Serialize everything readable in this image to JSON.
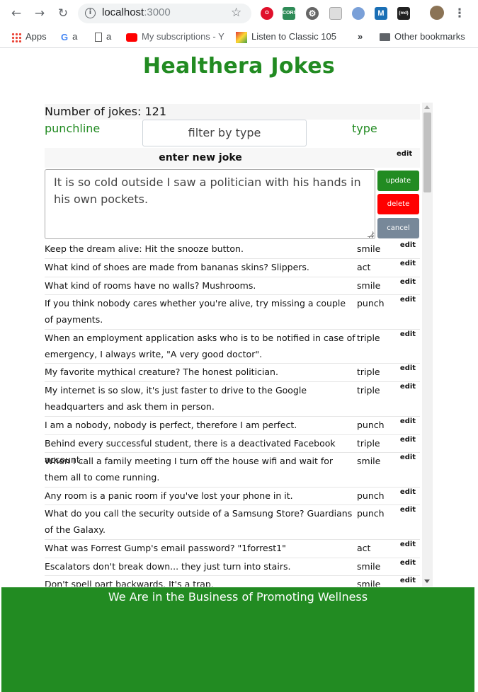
{
  "browser": {
    "url_host": "localhost",
    "url_port": ":3000",
    "bookmarks": {
      "apps": "Apps",
      "g_a": "a",
      "doc_a": "a",
      "youtube": "My subscriptions - Y",
      "classic": "Listen to Classic 105",
      "more": "»",
      "other": "Other bookmarks"
    },
    "extensions": [
      "opera-icon",
      "cors-icon",
      "gear-ext-icon",
      "calendar-ext-icon",
      "circle-ext-icon",
      "m-ext-icon",
      "terminal-ext-icon"
    ],
    "ext_labels": {
      "cors": "CORS",
      "m": "M",
      "terminal": "{md}"
    }
  },
  "page": {
    "title": "Healthera Jokes",
    "count_label": "Number of jokes: 121",
    "col_punchline": "punchline",
    "col_type": "type",
    "filter_placeholder": "filter by type",
    "new_joke_label": "enter new joke",
    "edit_label": "edit",
    "editor_text": "It is so cold outside I saw a politician with his hands in his own pockets.",
    "buttons": {
      "update": "update",
      "delete": "delete",
      "cancel": "cancel"
    },
    "footer": "We Are in the Business of Promoting Wellness"
  },
  "jokes": [
    {
      "text": "Keep the dream alive: Hit the snooze button.",
      "type": "smile"
    },
    {
      "text": "What kind of shoes are made from bananas skins? Slippers.",
      "type": "act"
    },
    {
      "text": "What kind of rooms have no walls? Mushrooms.",
      "type": "smile"
    },
    {
      "text": "If you think nobody cares whether you're alive, try missing a couple of payments.",
      "type": "punch"
    },
    {
      "text": "When an employment application asks who is to be notified in case of emergency, I always write, \"A very good doctor\".",
      "type": "triple"
    },
    {
      "text": "My favorite mythical creature? The honest politician.",
      "type": "triple"
    },
    {
      "text": "My internet is so slow, it's just faster to drive to the Google headquarters and ask them in person.",
      "type": "triple"
    },
    {
      "text": "I am a nobody, nobody is perfect, therefore I am perfect.",
      "type": "punch"
    },
    {
      "text": "Behind every successful student, there is a deactivated Facebook account.",
      "type": "triple"
    },
    {
      "text": "When I call a family meeting I turn off the house wifi and wait for them all to come running.",
      "type": "smile"
    },
    {
      "text": "Any room is a panic room if you've lost your phone in it.",
      "type": "punch"
    },
    {
      "text": "What do you call the security outside of a Samsung Store? Guardians of the Galaxy.",
      "type": "punch"
    },
    {
      "text": "What was Forrest Gump's email password? \"1forrest1\"",
      "type": "act"
    },
    {
      "text": "Escalators don't break down... they just turn into stairs.",
      "type": "smile"
    },
    {
      "text": "Don't spell part backwards. It's a trap.",
      "type": "smile"
    }
  ],
  "colors": {
    "brand_green": "#228b22",
    "delete_red": "#ff0000",
    "cancel_gray": "#778899"
  }
}
